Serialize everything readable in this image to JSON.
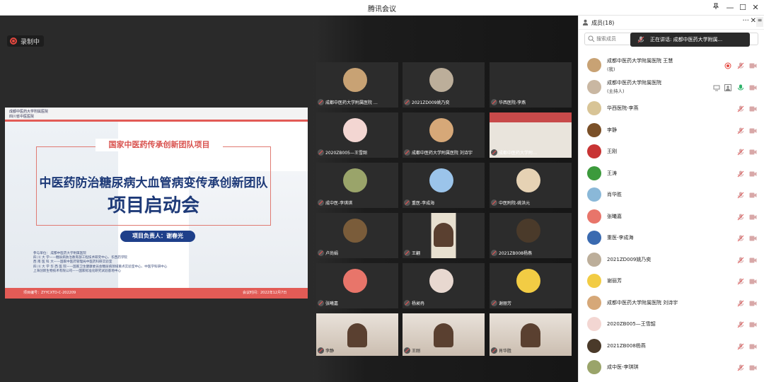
{
  "window": {
    "title": "腾讯会议",
    "pin_icon": "pin-icon",
    "minimize": "—",
    "maximize": "☐",
    "close": "✕"
  },
  "recording": {
    "label": "录制中",
    "icon": "record-icon"
  },
  "slide": {
    "logo_lines": [
      "成都中医药大学附属医院",
      "四川省中医医院"
    ],
    "tag": "国家中医药传承创新团队项目",
    "headline": "中医药防治糖尿病大血管病变传承创新团队",
    "subheadline": "项目启动会",
    "leader": "项目负责人：谢春光",
    "units": [
      "参与单位：  成都中医药大学附属医院",
      "四     川     大     学——糖尿病防治教育部工程技术研究中心、华西药学院",
      "西     南     医     科     大——国家中医药管理局中医药科研实验室",
      "四 川 大 学 华 西 医 院——国家卫生健康委员会糖尿病领域重点实验室中心、中医学科研中心",
      "上海创新生物技术有限公司——国家标准化研究试验基地中心"
    ],
    "footer_left": "项目编号：ZYYCXTD-C-202209",
    "footer_right": "会议时间：2022年12月7日",
    "colors": {
      "accent": "#e25b56",
      "navy": "#1e3a78"
    }
  },
  "video_grid": [
    {
      "name": "成都中医药大学附属医院 …",
      "avatar": "#c8a274"
    },
    {
      "name": "2021ZD009姚乃奕",
      "avatar": "#bcae9a"
    },
    {
      "name": "华西医院-李燕",
      "avatar": ""
    },
    {
      "name": "2020ZB005—王雪韶",
      "avatar": "#f3d6d2"
    },
    {
      "name": "成都中医药大学附属医院 刘诗宇",
      "avatar": "#d6a878"
    },
    {
      "name": "成都中医药大学附…",
      "avatar": "video"
    },
    {
      "name": "成中医-李琪琪",
      "avatar": "#9aa46a"
    },
    {
      "name": "重医-李成海",
      "avatar": "#9bc4ea"
    },
    {
      "name": "中医附院-姚洪元",
      "avatar": "#e6d2b4"
    },
    {
      "name": "卢尚娟",
      "avatar": "#7a5c3a"
    },
    {
      "name": "王翩",
      "avatar": "video"
    },
    {
      "name": "2021ZB008杨燕",
      "avatar": "#4a3a2a"
    },
    {
      "name": "张曦嘉",
      "avatar": "#e8756a"
    },
    {
      "name": "杨昶冉",
      "avatar": "#e8d8d0"
    },
    {
      "name": "谢丽芳",
      "avatar": "#f2cc44"
    },
    {
      "name": "李静",
      "avatar": "video"
    },
    {
      "name": "王刚",
      "avatar": "video"
    },
    {
      "name": "肖华胜",
      "avatar": "video"
    }
  ],
  "members_panel": {
    "title": "成员(18)",
    "more": "···",
    "close": "✕",
    "menu": "≡",
    "search_placeholder": "搜索成员",
    "speaking": "正在讲话: 成都中医药大学附属...",
    "members": [
      {
        "name": "成都中医药大学附属医院 王慧",
        "role": "(我)",
        "avatar": "#c8a274"
      },
      {
        "name": "成都中医药大学附属医院",
        "role": "(主持人)",
        "avatar": "#c9b7a2"
      },
      {
        "name": "华西医院-李燕",
        "role": "",
        "avatar": "#d8c496"
      },
      {
        "name": "李静",
        "role": "",
        "avatar": "#7a5028"
      },
      {
        "name": "王刚",
        "role": "",
        "avatar": "#c83434"
      },
      {
        "name": "王涛",
        "role": "",
        "avatar": "#3c9a3c"
      },
      {
        "name": "肖华胜",
        "role": "",
        "avatar": "#8ab8d8"
      },
      {
        "name": "张曦嘉",
        "role": "",
        "avatar": "#e8756a"
      },
      {
        "name": "重医-李成海",
        "role": "",
        "avatar": "#3a6ab0"
      },
      {
        "name": "2021ZD009姚乃奕",
        "role": "",
        "avatar": "#bcae9a"
      },
      {
        "name": "谢丽芳",
        "role": "",
        "avatar": "#f2cc44"
      },
      {
        "name": "成都中医药大学附属医院 刘诗宇",
        "role": "",
        "avatar": "#d6a878"
      },
      {
        "name": "2020ZB005—王雪韶",
        "role": "",
        "avatar": "#f3d6d2"
      },
      {
        "name": "2021ZB008杨燕",
        "role": "",
        "avatar": "#4a3a2a"
      },
      {
        "name": "成中医-李琪琪",
        "role": "",
        "avatar": "#9aa46a"
      }
    ]
  }
}
